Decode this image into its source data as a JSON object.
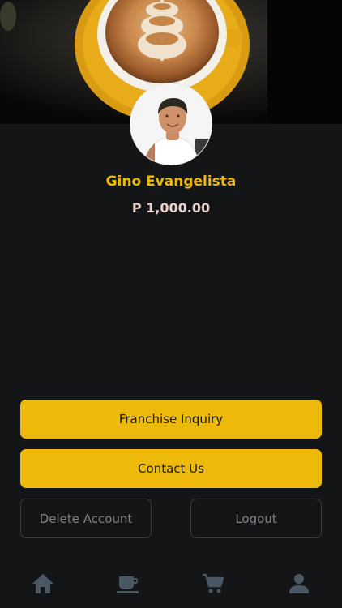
{
  "profile": {
    "name": "Gino Evangelista",
    "balance": "P 1,000.00"
  },
  "actions": {
    "franchise_label": "Franchise Inquiry",
    "contact_label": "Contact Us",
    "delete_label": "Delete Account",
    "logout_label": "Logout"
  },
  "nav": {
    "items": [
      {
        "icon": "home-icon"
      },
      {
        "icon": "coffee-cup-icon"
      },
      {
        "icon": "cart-icon"
      },
      {
        "icon": "profile-icon"
      }
    ],
    "active_index": 3
  },
  "colors": {
    "accent": "#EDB90A",
    "background": "#141517",
    "nav_icon": "#4a5866"
  }
}
